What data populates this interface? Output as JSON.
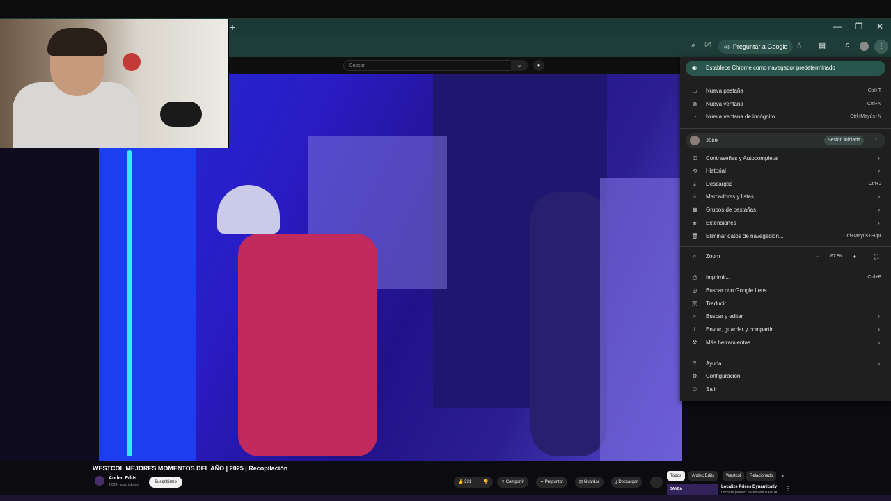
{
  "browser": {
    "new_tab_symbol": "+",
    "window_controls": [
      "—",
      "❐",
      "✕"
    ],
    "ask_google_label": "Preguntar a Google",
    "icons": [
      "zoom-icon",
      "cast-icon",
      "google-lens-icon",
      "bookmark-star-icon",
      "side-panel-icon",
      "media-control-icon",
      "profile-avatar-icon",
      "menu-dots-icon"
    ]
  },
  "youtube": {
    "search_placeholder": "Buscar",
    "video_title": "WESTCOL MEJORES MOMENTOS DEL AÑO | 2025 | Recopilación",
    "channel_name": "Andec Edits",
    "channel_subs": "2,02 K suscriptores",
    "subscribe_label": "Suscribirme",
    "actions": {
      "likes": "331",
      "share": "Compartir",
      "ask": "Preguntar",
      "save": "Guardar",
      "download": "Descargar",
      "more": "···"
    },
    "chips": [
      "Todos",
      "Andec Edits",
      "Westcol",
      "Relacionado"
    ],
    "chip_next": "›",
    "recommendation": {
      "thumb_label": "DANDA",
      "title": "Localize Prices Dynamically",
      "subtitle": "Localize product prices with DANDA"
    }
  },
  "chrome_menu": {
    "set_default": "Establece Chrome como navegador predeterminado",
    "group1": [
      {
        "icon": "new-tab-icon",
        "glyph": "▭",
        "label": "Nueva pestaña",
        "shortcut": "Ctrl+T"
      },
      {
        "icon": "new-window-icon",
        "glyph": "⧉",
        "label": "Nueva ventana",
        "shortcut": "Ctrl+N"
      },
      {
        "icon": "incognito-icon",
        "glyph": "◔",
        "label": "Nueva ventana de incógnito",
        "shortcut": "Ctrl+Mayús+N"
      }
    ],
    "profile": {
      "name": "Jose",
      "status": "Sesión iniciada",
      "arrow": "›"
    },
    "group2": [
      {
        "icon": "key-icon",
        "glyph": "⚿",
        "label": "Contraseñas y Autocompletar",
        "shortcut": "",
        "arrow": "›"
      },
      {
        "icon": "history-icon",
        "glyph": "⟲",
        "label": "Historial",
        "shortcut": "",
        "arrow": "›"
      },
      {
        "icon": "download-icon",
        "glyph": "⤓",
        "label": "Descargas",
        "shortcut": "Ctrl+J",
        "arrow": ""
      },
      {
        "icon": "star-icon",
        "glyph": "☆",
        "label": "Marcadores y listas",
        "shortcut": "",
        "arrow": "›"
      },
      {
        "icon": "tab-groups-icon",
        "glyph": "▦",
        "label": "Grupos de pestañas",
        "shortcut": "",
        "arrow": "›"
      },
      {
        "icon": "extensions-icon",
        "glyph": "⧈",
        "label": "Extensiones",
        "shortcut": "",
        "arrow": "›"
      },
      {
        "icon": "trash-icon",
        "glyph": "🗑",
        "label": "Eliminar datos de navegación...",
        "shortcut": "Ctrl+Mayús+Supr",
        "arrow": ""
      }
    ],
    "zoom": {
      "label": "Zoom",
      "minus": "−",
      "value": "67 %",
      "plus": "+",
      "fullscreen": "⛶"
    },
    "group3": [
      {
        "icon": "print-icon",
        "glyph": "⎙",
        "label": "Imprimir...",
        "shortcut": "Ctrl+P",
        "arrow": ""
      },
      {
        "icon": "google-lens-icon",
        "glyph": "◎",
        "label": "Buscar con Google Lens",
        "shortcut": "",
        "arrow": ""
      },
      {
        "icon": "translate-icon",
        "glyph": "文",
        "label": "Traducir...",
        "shortcut": "",
        "arrow": ""
      },
      {
        "icon": "find-icon",
        "glyph": "⌕",
        "label": "Buscar y editar",
        "shortcut": "",
        "arrow": "›"
      },
      {
        "icon": "share-icon",
        "glyph": "⇪",
        "label": "Enviar, guardar y compartir",
        "shortcut": "",
        "arrow": "›"
      },
      {
        "icon": "tools-icon",
        "glyph": "⚒",
        "label": "Más herramientas",
        "shortcut": "",
        "arrow": "›"
      }
    ],
    "group4": [
      {
        "icon": "help-icon",
        "glyph": "?",
        "label": "Ayuda",
        "shortcut": "",
        "arrow": "›"
      },
      {
        "icon": "settings-icon",
        "glyph": "⚙",
        "label": "Configuración",
        "shortcut": "",
        "arrow": ""
      },
      {
        "icon": "exit-icon",
        "glyph": "⎋",
        "label": "Salir",
        "shortcut": "",
        "arrow": ""
      }
    ]
  }
}
